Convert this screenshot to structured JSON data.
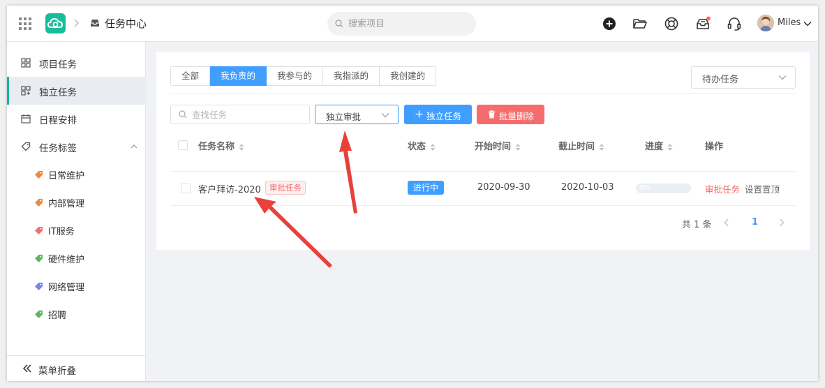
{
  "header": {
    "title": "任务中心",
    "search_placeholder": "搜索项目",
    "username": "Miles",
    "icons": [
      "apps-grid-icon",
      "cloud-logo-icon",
      "chevron-right-icon",
      "inbox-tray-icon",
      "plus-circle-icon",
      "folder-open-icon",
      "support-lifebuoy-icon",
      "notification-inbox-icon",
      "headset-icon",
      "avatar",
      "chevron-down-icon"
    ]
  },
  "sidebar": {
    "items": [
      {
        "label": "项目任务",
        "icon": "grid-icon"
      },
      {
        "label": "独立任务",
        "icon": "apps-icon",
        "active": true
      },
      {
        "label": "日程安排",
        "icon": "calendar-icon"
      },
      {
        "label": "任务标签",
        "icon": "tag-icon",
        "expanded": true
      }
    ],
    "tags": [
      {
        "label": "日常维护",
        "color": "#f0883e"
      },
      {
        "label": "内部管理",
        "color": "#f0883e"
      },
      {
        "label": "IT服务",
        "color": "#f56c6c"
      },
      {
        "label": "硬件维护",
        "color": "#5cb85c"
      },
      {
        "label": "网络管理",
        "color": "#7b83e8"
      },
      {
        "label": "招聘",
        "color": "#5cb85c"
      }
    ],
    "collapse_label": "菜单折叠"
  },
  "tabs": [
    "全部",
    "我负责的",
    "我参与的",
    "我指派的",
    "我创建的"
  ],
  "active_tab": "我负责的",
  "status_filter": "待办任务",
  "toolbar": {
    "search_placeholder": "查找任务",
    "type_select": "独立审批",
    "add_label": "独立任务",
    "delete_label": "批量删除"
  },
  "table": {
    "columns": [
      "任务名称",
      "状态",
      "开始时间",
      "截止时间",
      "进度",
      "操作"
    ],
    "rows": [
      {
        "name": "客户拜访-2020",
        "badge": "审批任务",
        "status": "进行中",
        "start": "2020-09-30",
        "end": "2020-10-03",
        "progress_text": "0%",
        "progress": 0,
        "action_approve": "审批任务",
        "action_pin": "设置置顶"
      }
    ]
  },
  "pagination": {
    "total": "共 1 条",
    "current": "1"
  },
  "colors": {
    "primary": "#409eff",
    "danger": "#f56c6c",
    "brand": "#1abc9c",
    "arrow": "#e8413c"
  }
}
